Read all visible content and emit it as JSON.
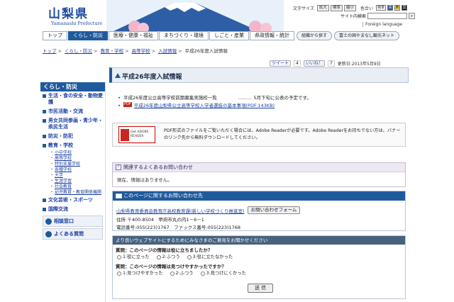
{
  "header": {
    "logo_kanji": "山梨県",
    "logo_en": "Yamanashi Prefecture",
    "font_size_label": "文字サイズ",
    "font_size_options": [
      "拡大",
      "標準",
      "縮小"
    ],
    "color_label": "色合い",
    "color_options": [
      "標準",
      "青",
      "黄",
      "黒"
    ],
    "search_label": "サイト内検索",
    "foreign_language": "Foreign language"
  },
  "nav": {
    "items": [
      "トップ",
      "くらし・防災",
      "医療・健康・福祉",
      "まちづくり・環境",
      "しごと・産業",
      "県政情報・統計"
    ],
    "pills": [
      "組織から探す",
      "富士の国やまなし観光ネット"
    ]
  },
  "breadcrumb": [
    "トップ",
    "くらし・防災",
    "教育・学校",
    "高等学校",
    "入試情報",
    "平成26年度入試情報"
  ],
  "social": {
    "tweet_label": "ツイート",
    "tweet_count": "4",
    "like_label": "いいね！",
    "like_count": "7",
    "updated": "更新日:2013年5月9日"
  },
  "sidebar": {
    "head": "くらし・防災",
    "categories": [
      "生活・食の安全・動物愛護",
      "市民活動・交流",
      "男女共同参画・青少年・県民生活",
      "防災・防犯",
      "教育・学校"
    ],
    "sub_items": [
      "小中学校",
      "高等学校",
      "特別支援学校",
      "各種学校",
      "大学",
      "生涯学習",
      "社会教育",
      "幼児教育・教育関係機関"
    ],
    "categories_after": [
      "文化芸術・スポーツ",
      "国際交流"
    ],
    "bottom_links": [
      "相談窓口",
      "よくある質問"
    ]
  },
  "main": {
    "title": "平成26年度入試情報",
    "item1": "平成26年度公立高等学校前期募集実施校一覧",
    "item1_note": "……… 5月下旬に公表の予定です。",
    "pdf_tag": "PDF",
    "item2_link": "平成26年度山梨県公立高等学校入学者選抜の基本事項(PDF:143KB)",
    "adobe_logo_text": "Get ADOBE READER",
    "adobe_text": "PDF形式のファイルをご覧いただく場合には、Adobe Readerが必要です。Adobe Readerをお持ちでない方は、バナーのリンク先から無料ダウンロードしてください。",
    "related_head": "関連するよくあるお問い合わせ",
    "related_body": "現在、情報はありません。",
    "contact_head": "このページに関するお問い合わせ先",
    "contact_dept": "山梨県教育委員会教育庁高校教育課(新しい学校づくり推進室)",
    "contact_form_btn": "お問い合わせフォーム",
    "contact_address": "住所:〒400-8504　甲府市丸の内1－6－1",
    "contact_phone": "電話番号:055(223)1767　ファックス番号:055(223)1768",
    "survey_head": "より良いウェブサイトにするためにみなさまのご意見をお聞かせください",
    "survey_q1": "質問：このページの情報は役に立ちましたか？",
    "survey_q1_opts": [
      "1:役に立った",
      "2:ふつう",
      "3:役に立たなかった"
    ],
    "survey_q2": "質問：このページの情報は見つけやすかったですか？",
    "survey_q2_opts": [
      "1:見つけやすかった",
      "2:ふつう",
      "3:見つけにくかった"
    ],
    "send_label": "送 信"
  },
  "colors": {
    "primary_blue": "#1f5a9c",
    "pdf_red": "#c8261f",
    "related_bg": "#ede8f3"
  }
}
